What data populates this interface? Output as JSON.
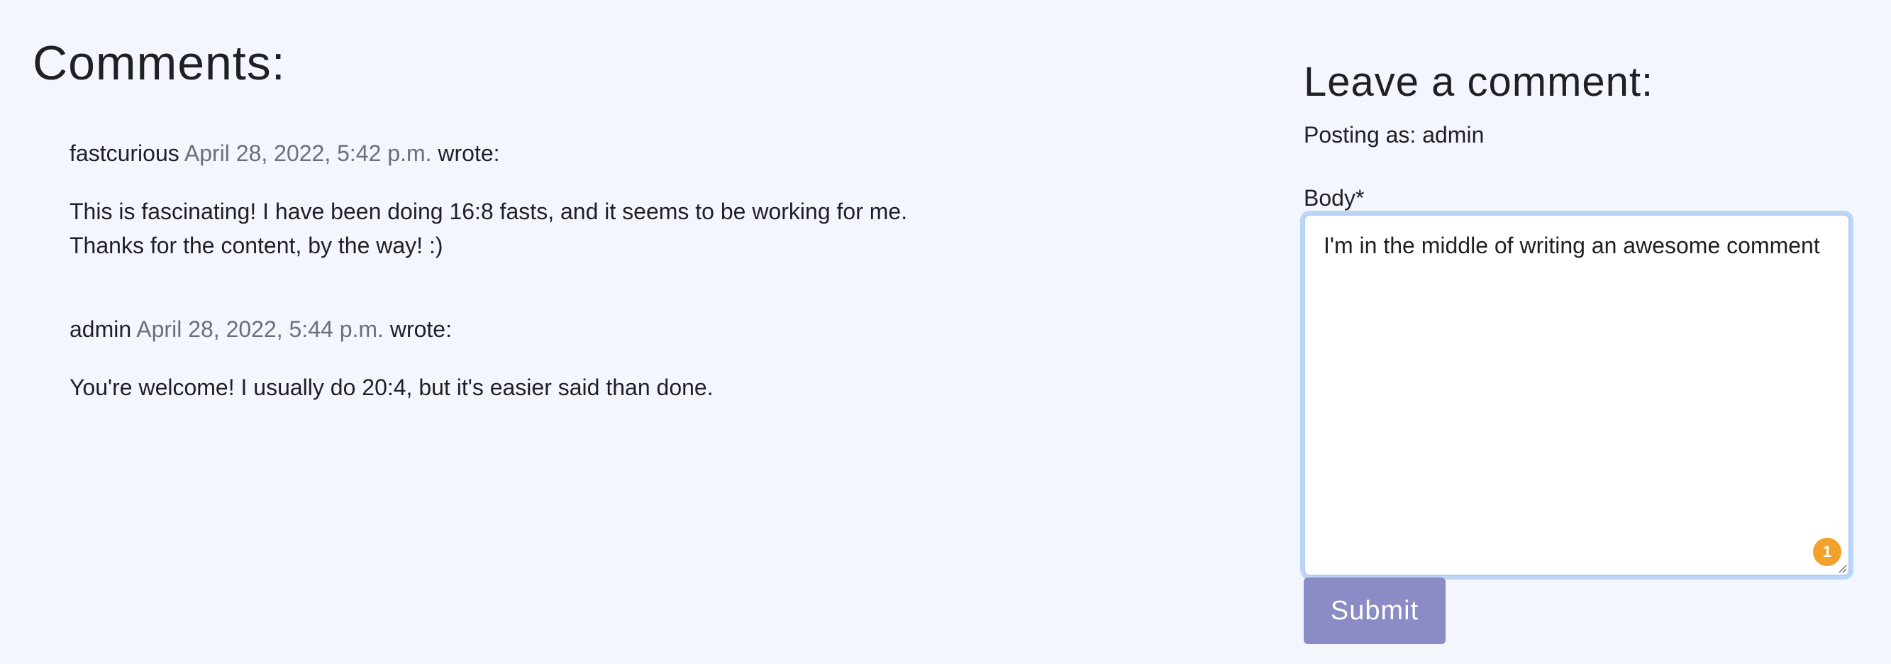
{
  "comments_section": {
    "title": "Comments:",
    "items": [
      {
        "author": "fastcurious",
        "date": "April 28, 2022, 5:42 p.m.",
        "wrote": "wrote:",
        "body": "This is fascinating! I have been doing 16:8 fasts, and it seems to be working for me.\nThanks for the content, by the way! :)"
      },
      {
        "author": "admin",
        "date": "April 28, 2022, 5:44 p.m.",
        "wrote": "wrote:",
        "body": "You're welcome! I usually do 20:4, but it's easier said than done."
      }
    ]
  },
  "comment_form": {
    "title": "Leave a comment:",
    "posting_as": "Posting as: admin",
    "body_label": "Body*",
    "body_value": "I'm in the middle of writing an awesome comment",
    "badge_count": "1",
    "submit_label": "Submit"
  },
  "colors": {
    "page_background": "#f3f7fd",
    "date_text": "#6e6e76",
    "submit_button": "#8b8bc5",
    "focus_ring": "#bcd6f7",
    "badge": "#f2a12a"
  }
}
